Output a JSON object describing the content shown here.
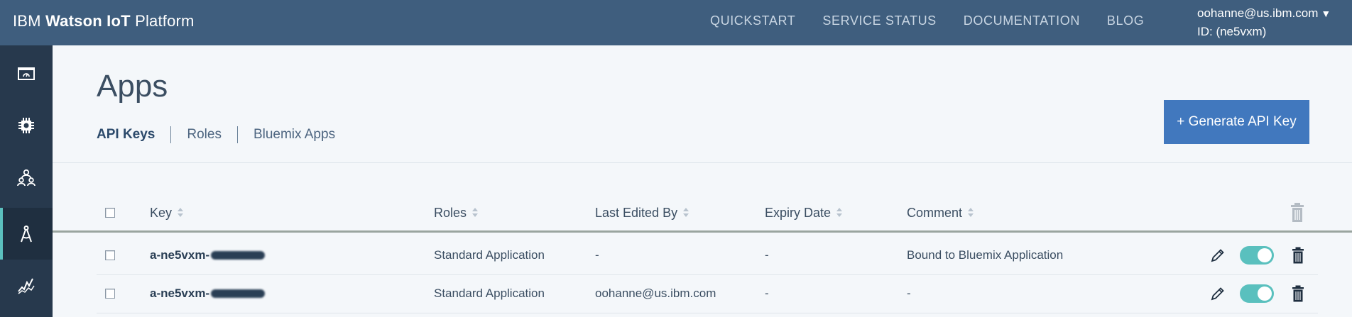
{
  "header": {
    "brand_prefix": "IBM ",
    "brand_bold": "Watson IoT",
    "brand_suffix": " Platform",
    "nav": [
      "QUICKSTART",
      "SERVICE STATUS",
      "DOCUMENTATION",
      "BLOG"
    ],
    "user_email": "oohanne@us.ibm.com",
    "user_caret": "▼",
    "user_id": "ID: (ne5vxm)"
  },
  "sidebar": {
    "items": [
      {
        "icon": "dashboard-icon",
        "active": false
      },
      {
        "icon": "devices-chip-icon",
        "active": false
      },
      {
        "icon": "members-icon",
        "active": false
      },
      {
        "icon": "apps-compass-icon",
        "active": true
      },
      {
        "icon": "usage-chart-icon",
        "active": false
      }
    ]
  },
  "main": {
    "title": "Apps",
    "tabs": [
      {
        "label": "API Keys",
        "active": true
      },
      {
        "label": "Roles",
        "active": false
      },
      {
        "label": "Bluemix Apps",
        "active": false
      }
    ],
    "generate_button": "+ Generate API Key"
  },
  "table": {
    "columns": [
      "Key",
      "Roles",
      "Last Edited By",
      "Expiry Date",
      "Comment"
    ],
    "rows": [
      {
        "key": "a-ne5vxm-",
        "roles": "Standard Application",
        "last_edited_by": "-",
        "expiry": "-",
        "comment": "Bound to Bluemix Application",
        "enabled": true
      },
      {
        "key": "a-ne5vxm-",
        "roles": "Standard Application",
        "last_edited_by": "oohanne@us.ibm.com",
        "expiry": "-",
        "comment": "-",
        "enabled": true
      }
    ]
  },
  "colors": {
    "header_bg": "#3f5e7e",
    "sidebar_bg": "#27394d",
    "accent_teal": "#5ac0be",
    "button_blue": "#4178be"
  }
}
